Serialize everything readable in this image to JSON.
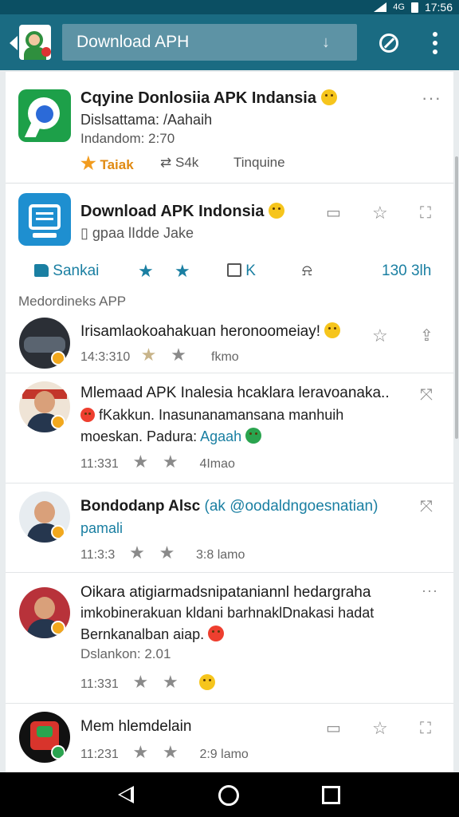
{
  "status": {
    "time": "17:56",
    "signal_label": "4G"
  },
  "appbar": {
    "search_text": "Download APH"
  },
  "card1": {
    "title": "Cqyine Donlosiia APK Indansia",
    "subtitle": "Dislsattama: /Aahaih",
    "detail": "Indandom: 2:70",
    "rating_label": "Taiak",
    "downloads": "S4k",
    "category": "Tinquine"
  },
  "card2": {
    "title": "Download APK Indonsia",
    "subtitle": "gpaa  lIdde Jake"
  },
  "actions": {
    "like_label": "Sankai",
    "comment_label": "K",
    "count": "130 3lh"
  },
  "section_title": "Medordineks APP",
  "rows": [
    {
      "title": "Irisamlaokoahakuan heronoomeiay!",
      "time": "14:3:310",
      "extra": "fkmo"
    },
    {
      "title": "Mlemaad APK Inalesia hcaklara leravoanaka..",
      "line2": "fKakkun. Inasunanamansana manhuih",
      "line3a": "moeskan. Padura: ",
      "line3b": "Agaah",
      "time": "11:331",
      "extra": "4Imao"
    },
    {
      "title": "Bondodanp Alsc",
      "handle": "(ak @oodaldngoesnatian)",
      "line2": "pamali",
      "time": "11:3:3",
      "extra": "3:8 lamo"
    },
    {
      "title": "Oikara atigiarmadsnipataniannl hedargraha",
      "line2": "imkobinerakuan kldani barhnaklDnakasi hadat",
      "line3": "Bernkanalban aiap.",
      "line4": "Dslankon: 2.01",
      "time": "11:331"
    },
    {
      "title": "Mem hlemdelain",
      "time": "11:231",
      "extra": "2:9 lamo"
    }
  ]
}
